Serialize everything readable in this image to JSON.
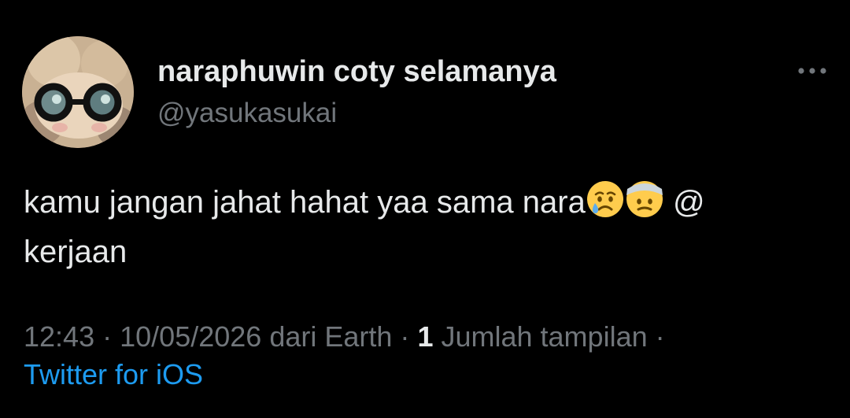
{
  "user": {
    "display_name": "naraphuwin coty selamanya",
    "handle": "@yasukasukai"
  },
  "tweet": {
    "text_line1": "kamu jangan jahat hahat yaa sama nara",
    "emoji_1": "crying-face",
    "emoji_2": "face-with-head-bandage",
    "text_line1_suffix": "@",
    "text_line2": "kerjaan"
  },
  "meta": {
    "time": "12:43",
    "sep1": "·",
    "date": "10/05/2026",
    "location": "dari Earth",
    "sep2": "·",
    "views_count": "1",
    "views_label": "Jumlah tampilan",
    "sep3": "·",
    "source": "Twitter for iOS"
  },
  "icons": {
    "more": "more-horizontal-icon"
  },
  "colors": {
    "background": "#000000",
    "primary_text": "#e7e9ea",
    "secondary_text": "#71767b",
    "link": "#1d9bf0"
  }
}
